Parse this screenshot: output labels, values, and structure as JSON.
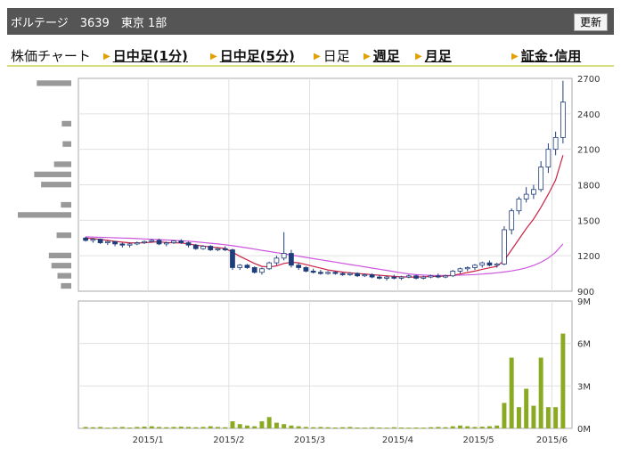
{
  "header": {
    "title": "ボルテージ　3639　東京 1部",
    "refresh_label": "更新"
  },
  "nav": {
    "chart_label": "株価チャート",
    "items": [
      {
        "label": "日中足(1分)",
        "link": true
      },
      {
        "label": "日中足(5分)",
        "link": true
      },
      {
        "label": "日足",
        "link": false
      },
      {
        "label": "週足",
        "link": true
      },
      {
        "label": "月足",
        "link": true
      },
      {
        "label": "証金･信用",
        "link": true
      }
    ]
  },
  "colors": {
    "up_candle": "#ffffff",
    "down_candle": "#1f3d7a",
    "ma_short": "#cc2244",
    "ma_long": "#cc55dd",
    "volume_bar": "#8aaa22",
    "vol_profile": "#999999",
    "grid": "#e0e0e0",
    "frame": "#aaaaaa"
  },
  "chart_data": {
    "type": "candlestick",
    "price_axis": {
      "ylim": [
        900,
        2700
      ],
      "ticks": [
        "2700",
        "2400",
        "2100",
        "1800",
        "1500",
        "1200",
        "900"
      ]
    },
    "volume_axis": {
      "ylim": [
        0,
        9
      ],
      "unit": "M",
      "ticks": [
        "9M",
        "6M",
        "3M",
        "0M"
      ]
    },
    "x_ticks": [
      "2015/1",
      "2015/2",
      "2015/3",
      "2015/4",
      "2015/5",
      "2015/6"
    ],
    "candles_note": "daily OHLC approximated from image",
    "candles": [
      [
        1350,
        1360,
        1320,
        1330
      ],
      [
        1330,
        1350,
        1310,
        1340
      ],
      [
        1340,
        1345,
        1300,
        1310
      ],
      [
        1310,
        1330,
        1290,
        1320
      ],
      [
        1320,
        1325,
        1280,
        1300
      ],
      [
        1300,
        1310,
        1270,
        1290
      ],
      [
        1290,
        1310,
        1270,
        1300
      ],
      [
        1300,
        1320,
        1290,
        1310
      ],
      [
        1310,
        1330,
        1300,
        1320
      ],
      [
        1320,
        1340,
        1310,
        1330
      ],
      [
        1330,
        1345,
        1290,
        1300
      ],
      [
        1300,
        1320,
        1280,
        1310
      ],
      [
        1310,
        1330,
        1300,
        1325
      ],
      [
        1325,
        1340,
        1300,
        1310
      ],
      [
        1310,
        1320,
        1270,
        1290
      ],
      [
        1290,
        1300,
        1250,
        1260
      ],
      [
        1260,
        1290,
        1250,
        1280
      ],
      [
        1280,
        1290,
        1240,
        1250
      ],
      [
        1250,
        1270,
        1240,
        1260
      ],
      [
        1260,
        1280,
        1240,
        1250
      ],
      [
        1250,
        1260,
        1080,
        1100
      ],
      [
        1100,
        1130,
        1080,
        1120
      ],
      [
        1120,
        1130,
        1090,
        1100
      ],
      [
        1100,
        1110,
        1050,
        1060
      ],
      [
        1060,
        1100,
        1040,
        1090
      ],
      [
        1090,
        1150,
        1080,
        1140
      ],
      [
        1140,
        1200,
        1120,
        1180
      ],
      [
        1180,
        1400,
        1160,
        1220
      ],
      [
        1220,
        1250,
        1100,
        1120
      ],
      [
        1120,
        1140,
        1080,
        1100
      ],
      [
        1100,
        1110,
        1060,
        1070
      ],
      [
        1070,
        1090,
        1050,
        1060
      ],
      [
        1060,
        1080,
        1040,
        1050
      ],
      [
        1050,
        1070,
        1040,
        1060
      ],
      [
        1060,
        1070,
        1040,
        1050
      ],
      [
        1050,
        1060,
        1030,
        1040
      ],
      [
        1040,
        1060,
        1030,
        1050
      ],
      [
        1050,
        1060,
        1020,
        1030
      ],
      [
        1030,
        1050,
        1020,
        1040
      ],
      [
        1040,
        1050,
        1010,
        1020
      ],
      [
        1020,
        1040,
        1000,
        1010
      ],
      [
        1010,
        1030,
        990,
        1020
      ],
      [
        1020,
        1040,
        1000,
        1010
      ],
      [
        1010,
        1030,
        995,
        1020
      ],
      [
        1020,
        1040,
        1010,
        1030
      ],
      [
        1030,
        1040,
        1000,
        1010
      ],
      [
        1010,
        1030,
        1000,
        1020
      ],
      [
        1020,
        1040,
        1010,
        1030
      ],
      [
        1030,
        1050,
        1010,
        1020
      ],
      [
        1020,
        1040,
        1010,
        1030
      ],
      [
        1030,
        1080,
        1020,
        1070
      ],
      [
        1070,
        1100,
        1050,
        1090
      ],
      [
        1090,
        1110,
        1070,
        1100
      ],
      [
        1100,
        1130,
        1080,
        1120
      ],
      [
        1120,
        1150,
        1100,
        1140
      ],
      [
        1140,
        1160,
        1110,
        1120
      ],
      [
        1120,
        1140,
        1100,
        1130
      ],
      [
        1130,
        1450,
        1120,
        1420
      ],
      [
        1420,
        1600,
        1380,
        1580
      ],
      [
        1580,
        1700,
        1550,
        1680
      ],
      [
        1680,
        1780,
        1650,
        1720
      ],
      [
        1720,
        1800,
        1680,
        1760
      ],
      [
        1760,
        2000,
        1740,
        1950
      ],
      [
        1950,
        2150,
        1900,
        2100
      ],
      [
        2100,
        2250,
        2050,
        2200
      ],
      [
        2200,
        2680,
        2150,
        2500
      ]
    ],
    "ma_short": [
      1350,
      1345,
      1338,
      1330,
      1322,
      1315,
      1310,
      1308,
      1310,
      1315,
      1318,
      1312,
      1310,
      1308,
      1300,
      1290,
      1282,
      1275,
      1268,
      1262,
      1230,
      1195,
      1165,
      1135,
      1110,
      1105,
      1115,
      1135,
      1145,
      1140,
      1125,
      1110,
      1095,
      1080,
      1070,
      1062,
      1056,
      1050,
      1045,
      1040,
      1035,
      1030,
      1025,
      1022,
      1020,
      1020,
      1022,
      1024,
      1026,
      1028,
      1035,
      1045,
      1058,
      1070,
      1085,
      1098,
      1110,
      1160,
      1250,
      1340,
      1430,
      1510,
      1610,
      1720,
      1840,
      2050
    ],
    "ma_long": [
      1360,
      1358,
      1356,
      1354,
      1352,
      1350,
      1348,
      1345,
      1342,
      1339,
      1336,
      1333,
      1330,
      1327,
      1323,
      1318,
      1312,
      1306,
      1300,
      1293,
      1285,
      1276,
      1266,
      1256,
      1246,
      1236,
      1226,
      1216,
      1206,
      1196,
      1186,
      1176,
      1166,
      1156,
      1146,
      1136,
      1126,
      1116,
      1106,
      1096,
      1086,
      1076,
      1066,
      1056,
      1046,
      1040,
      1036,
      1034,
      1033,
      1033,
      1034,
      1036,
      1038,
      1041,
      1045,
      1050,
      1056,
      1063,
      1072,
      1083,
      1098,
      1118,
      1145,
      1180,
      1230,
      1300
    ],
    "volume": [
      0.1,
      0.08,
      0.1,
      0.05,
      0.08,
      0.1,
      0.06,
      0.1,
      0.12,
      0.15,
      0.1,
      0.08,
      0.1,
      0.12,
      0.1,
      0.08,
      0.1,
      0.15,
      0.1,
      0.08,
      0.5,
      0.3,
      0.2,
      0.15,
      0.5,
      0.8,
      0.4,
      0.3,
      0.2,
      0.15,
      0.1,
      0.08,
      0.1,
      0.08,
      0.06,
      0.08,
      0.1,
      0.06,
      0.05,
      0.08,
      0.06,
      0.05,
      0.08,
      0.06,
      0.05,
      0.06,
      0.05,
      0.08,
      0.1,
      0.08,
      0.15,
      0.2,
      0.15,
      0.1,
      0.12,
      0.15,
      0.2,
      1.8,
      5,
      1.5,
      2.8,
      1.6,
      5,
      1.5,
      1.5,
      6.7
    ],
    "volume_profile": [
      4,
      0,
      0,
      0,
      1.1,
      0,
      1,
      0,
      2,
      4.3,
      3.5,
      0,
      1.2,
      6.2,
      0,
      1.7,
      0,
      2.6,
      2.3,
      1.6,
      1.2
    ]
  }
}
